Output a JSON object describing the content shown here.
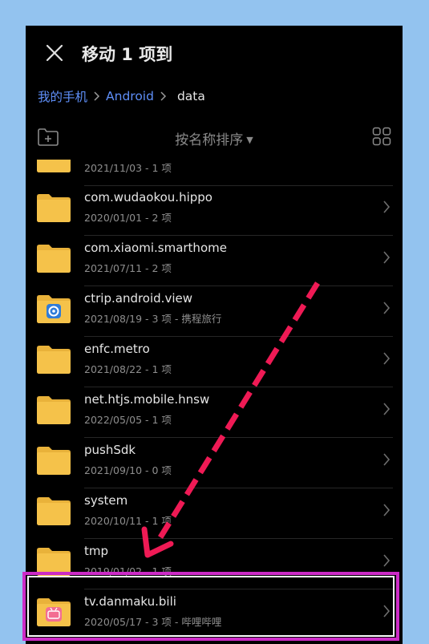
{
  "header": {
    "title": "移动 1 项到"
  },
  "breadcrumb": {
    "items": [
      "我的手机",
      "Android"
    ],
    "current": "data"
  },
  "toolbar": {
    "sort_label": "按名称排序",
    "sort_caret": "▼"
  },
  "colors": {
    "folder": "#f5c24a",
    "folder_tab": "#e9b23a",
    "accent_link": "#5e8ef7",
    "highlight": "#cc2bc6",
    "arrow": "#ef1a55"
  },
  "list": {
    "partial_meta": "2021/11/03 - 1 项",
    "items": [
      {
        "name": "com.wudaokou.hippo",
        "meta": "2020/01/01 - 2 项",
        "icon": "folder-icon"
      },
      {
        "name": "com.xiaomi.smarthome",
        "meta": "2021/07/11 - 2 项",
        "icon": "folder-icon"
      },
      {
        "name": "ctrip.android.view",
        "meta": "2021/08/19 - 3 项 - 携程旅行",
        "icon": "ctrip-folder-icon"
      },
      {
        "name": "enfc.metro",
        "meta": "2021/08/22 - 1 项",
        "icon": "folder-icon"
      },
      {
        "name": "net.htjs.mobile.hnsw",
        "meta": "2022/05/05 - 1 项",
        "icon": "folder-icon"
      },
      {
        "name": "pushSdk",
        "meta": "2021/09/10 - 0 项",
        "icon": "folder-icon"
      },
      {
        "name": "system",
        "meta": "2020/10/11 - 1 项",
        "icon": "folder-icon"
      },
      {
        "name": "tmp",
        "meta": "2019/01/02 - 1 项",
        "icon": "folder-icon"
      },
      {
        "name": "tv.danmaku.bili",
        "meta": "2020/05/17 - 3 项 - 哔哩哔哩",
        "icon": "bilibili-folder-icon"
      }
    ]
  }
}
